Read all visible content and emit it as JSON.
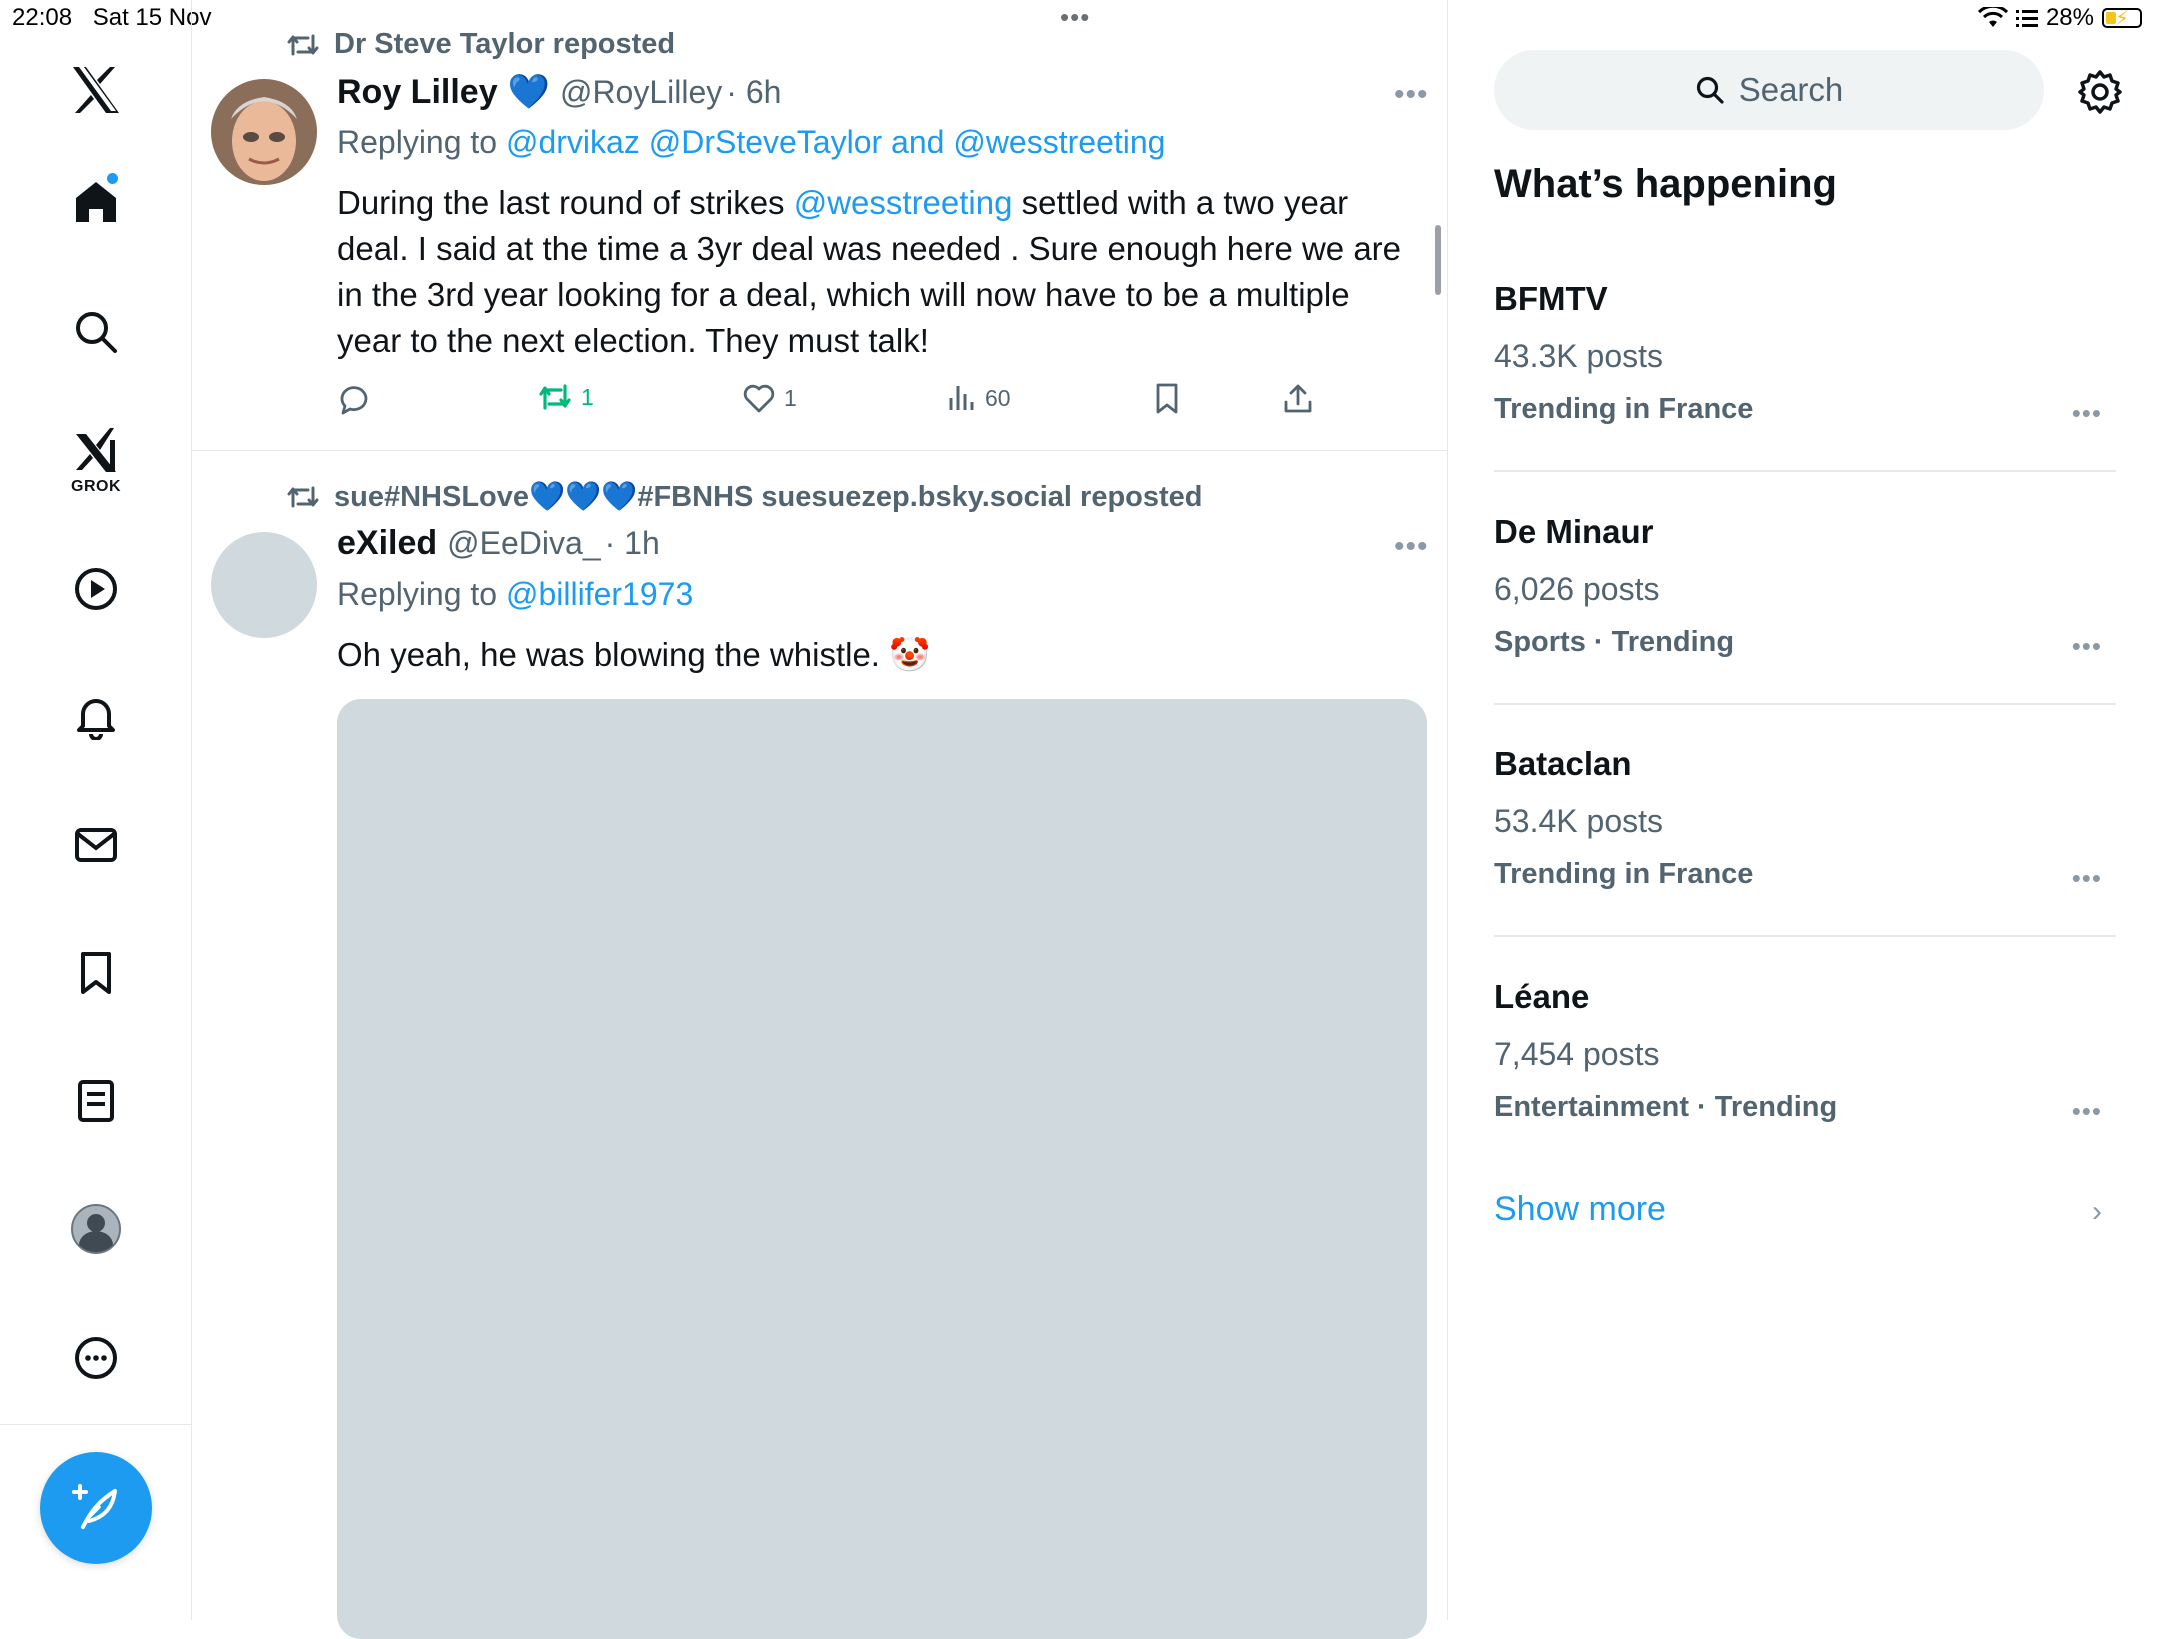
{
  "status_bar": {
    "time": "22:08",
    "date": "Sat 15 Nov",
    "battery": "28%",
    "battery_level": 0.28
  },
  "nav": {
    "grok_label": "GROK"
  },
  "tweets": [
    {
      "repost_by": "Dr Steve Taylor reposted",
      "name": "Roy Lilley",
      "verified_emoji": "💙",
      "handle": "@RoyLilley",
      "time": "· 6h",
      "replying_prefix": "Replying to ",
      "replying_handles": "@drvikaz @DrSteveTaylor and @wesstreeting",
      "text_lines": [
        {
          "before": "During the last round of strikes ",
          "mention": "@wesstreeting",
          "after": " settled with a two year"
        },
        "deal. I said at the time a 3yr deal was needed . Sure enough here we are",
        "in the 3rd year looking for a deal, which will now have to be a multiple",
        "year to the next election. They must talk!"
      ],
      "stats": {
        "retweets": "1",
        "likes": "1",
        "views": "60"
      }
    },
    {
      "repost_by": "sue#NHSLove💙💙💙#FBNHS suesuezep.bsky.social reposted",
      "name": "eXiled",
      "handle": "@EeDiva_",
      "time": "· 1h",
      "replying_prefix": "Replying to ",
      "replying_handles": "@billifer1973",
      "text": "Oh yeah, he was blowing the whistle. 🤡"
    }
  ],
  "sidebar": {
    "search_placeholder": "Search",
    "section_title": "What’s happening",
    "trends": [
      {
        "topic": "BFMTV",
        "count": "43.3K posts",
        "context": "Trending in France"
      },
      {
        "topic": "De Minaur",
        "count": "6,026 posts",
        "context": "Sports · Trending"
      },
      {
        "topic": "Bataclan",
        "count": "53.4K posts",
        "context": "Trending in France"
      },
      {
        "topic": "Léane",
        "count": "7,454 posts",
        "context": "Entertainment · Trending"
      }
    ],
    "show_more": "Show more"
  },
  "colors": {
    "accent": "#1d9bf0",
    "retweet_green": "#00ba7c",
    "muted": "#536471"
  }
}
